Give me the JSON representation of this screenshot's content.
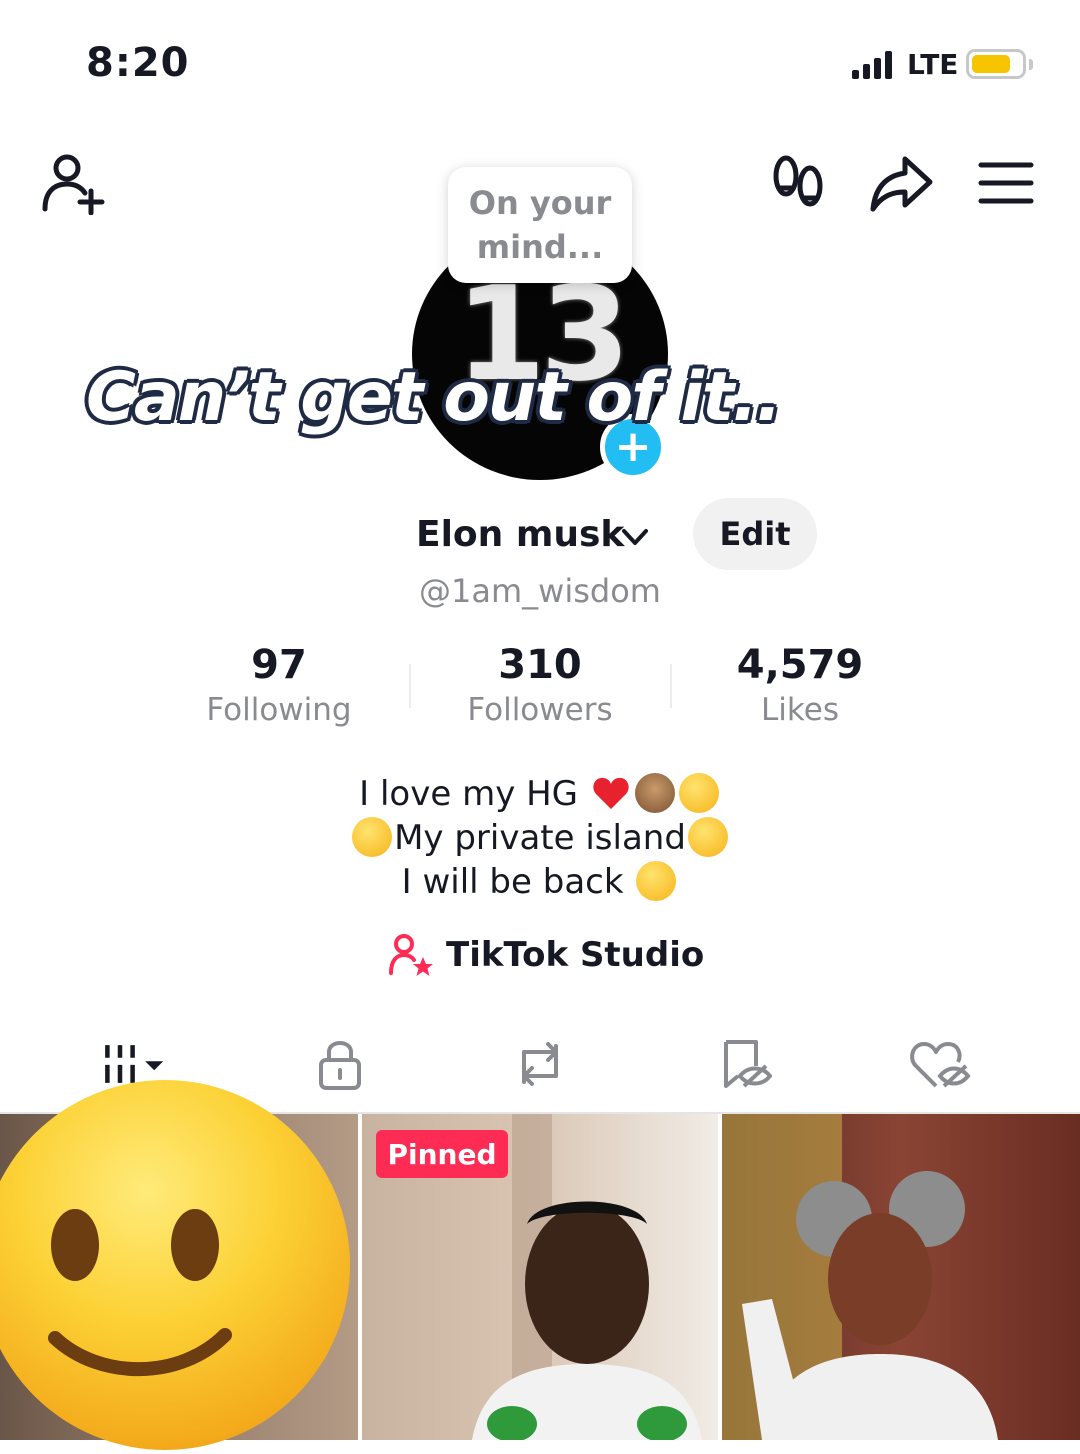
{
  "status_bar": {
    "time": "8:20",
    "network": "LTE"
  },
  "top_bar": {
    "icons": [
      "add-friend-icon",
      "footprint-icon",
      "share-icon",
      "menu-icon"
    ]
  },
  "avatar": {
    "text": "13",
    "bubble_text_line1": "On your",
    "bubble_text_line2": "mind..."
  },
  "overlay_caption": "Can’t get out of it..",
  "profile": {
    "display_name": "Elon musk",
    "edit_label": "Edit",
    "username": "@1am_wisdom"
  },
  "stats": [
    {
      "value": "97",
      "label": "Following"
    },
    {
      "value": "310",
      "label": "Followers"
    },
    {
      "value": "4,579",
      "label": "Likes"
    }
  ],
  "bio": {
    "line1": "I love my HG",
    "line2": "My private island",
    "line3": "I will be back"
  },
  "studio_label": "TikTok Studio",
  "tabs": [
    "videos-grid-icon",
    "lock-icon",
    "repost-icon",
    "favorites-icon",
    "liked-icon"
  ],
  "grid": {
    "pinned_label": "Pinned"
  },
  "colors": {
    "accent": "#fe2c55",
    "badge_blue": "#21bdf3",
    "secondary_text": "#8a8b91",
    "battery": "#f6c400"
  }
}
